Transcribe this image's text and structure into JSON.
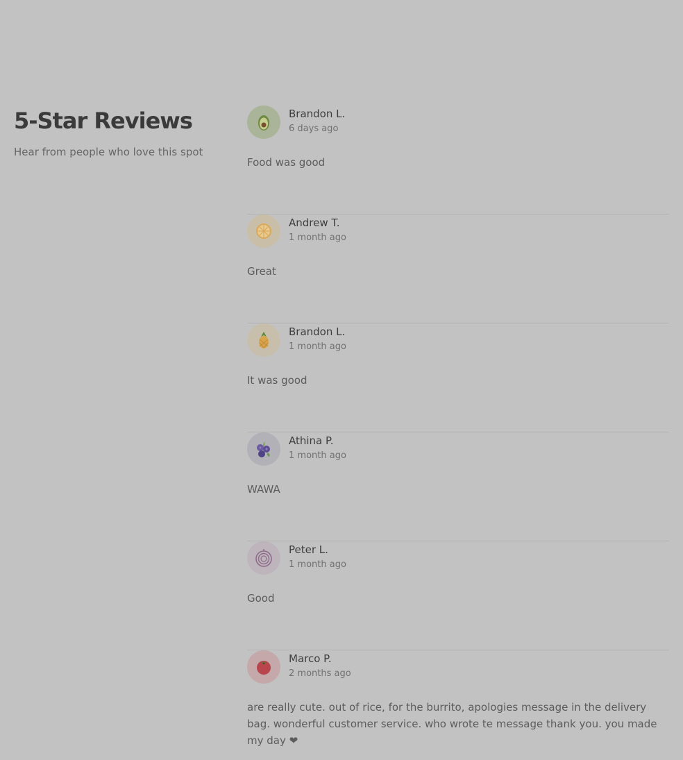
{
  "section": {
    "title": "5-Star Reviews",
    "subtitle": "Hear from people who love this spot"
  },
  "reviews": [
    {
      "name": "Brandon L.",
      "date": "6 days ago",
      "text": "Food was good",
      "avatar_icon": "avocado-icon",
      "avatar_bg": "#a9b498"
    },
    {
      "name": "Andrew T.",
      "date": "1 month ago",
      "text": "Great",
      "avatar_icon": "orange-slice-icon",
      "avatar_bg": "#c9bfa8"
    },
    {
      "name": "Brandon L.",
      "date": "1 month ago",
      "text": "It was good",
      "avatar_icon": "pineapple-icon",
      "avatar_bg": "#c7bfac"
    },
    {
      "name": "Athina P.",
      "date": "1 month ago",
      "text": "WAWA",
      "avatar_icon": "blueberries-icon",
      "avatar_bg": "#b3b1b8"
    },
    {
      "name": "Peter L.",
      "date": "1 month ago",
      "text": "Good",
      "avatar_icon": "onion-icon",
      "avatar_bg": "#beb5bc"
    },
    {
      "name": "Marco P.",
      "date": "2 months ago",
      "text": "are really cute. out of rice, for the burrito, apologies message in the delivery bag. wonderful customer service. who wrote te message thank you. you made my day ❤",
      "avatar_icon": "tomato-icon",
      "avatar_bg": "#c4a8aa"
    }
  ]
}
